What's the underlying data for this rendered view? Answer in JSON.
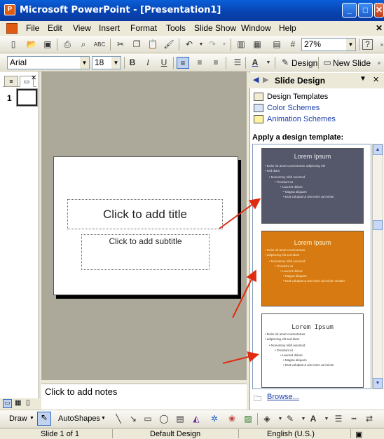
{
  "window": {
    "title": "Microsoft PowerPoint - [Presentation1]",
    "minimize": "_",
    "maximize": "□",
    "close": "✕"
  },
  "menu": [
    "File",
    "Edit",
    "View",
    "Insert",
    "Format",
    "Tools",
    "Slide Show",
    "Window",
    "Help"
  ],
  "toolbar": {
    "zoom": "27%",
    "help_icon": "?"
  },
  "format_bar": {
    "font": "Arial",
    "size": "18",
    "bold": "B",
    "italic": "I",
    "underline": "U",
    "font_color_letter": "A",
    "design_label": "Design",
    "new_slide_label": "New Slide"
  },
  "left_panel": {
    "slide_number": "1"
  },
  "slide": {
    "title_placeholder": "Click to add title",
    "subtitle_placeholder": "Click to add subtitle"
  },
  "notes": {
    "placeholder": "Click to add notes"
  },
  "task_pane": {
    "title": "Slide Design",
    "links": [
      "Design Templates",
      "Color Schemes",
      "Animation Schemes"
    ],
    "section_heading": "Apply a design template:",
    "browse": "Browse..."
  },
  "templates": [
    {
      "title": "Lorem Ipsum",
      "bullets": [
        "Dolor sit amet consectetuer adipiscing elit",
        "sed diam",
        "Nonummy nibh euismod",
        "Tincidunt ut",
        "Laoreet dolore",
        "Magna aliquam",
        "Erat volutpat ut wisi enim ad minim"
      ],
      "bg": "#55576a",
      "fg": "#e8e8f0"
    },
    {
      "title": "Lorem Ipsum",
      "bullets": [
        "Dolor sit amet consectetuer",
        "adipiscing elit sed diam",
        "Nonummy nibh euismod",
        "Tincidunt ut",
        "Laoreet dolore",
        "Magna aliquam",
        "Erat volutpat ut wisi enim ad minim veniam"
      ],
      "bg": "#d87a12",
      "fg": "#fff3c8"
    },
    {
      "title": "Lorem Ipsum",
      "bullets": [
        "Dolor sit amet consectetuer",
        "adipiscing elit sed diam",
        "Nonummy nibh euismod",
        "Tincidunt ut",
        "Laoreet dolore",
        "Magna aliquam",
        "Erat volutpat ut wisi enim ad minim"
      ],
      "bg": "#ffffff",
      "fg": "#333333"
    }
  ],
  "draw_bar": {
    "draw": "Draw",
    "autoshapes": "AutoShapes"
  },
  "status": {
    "slide": "Slide 1 of 1",
    "design": "Default Design",
    "language": "English (U.S.)"
  },
  "colors": {
    "accent_arrow": "#e02b10",
    "titlebar": "#0a5fd8",
    "link": "#1c3fa8"
  }
}
